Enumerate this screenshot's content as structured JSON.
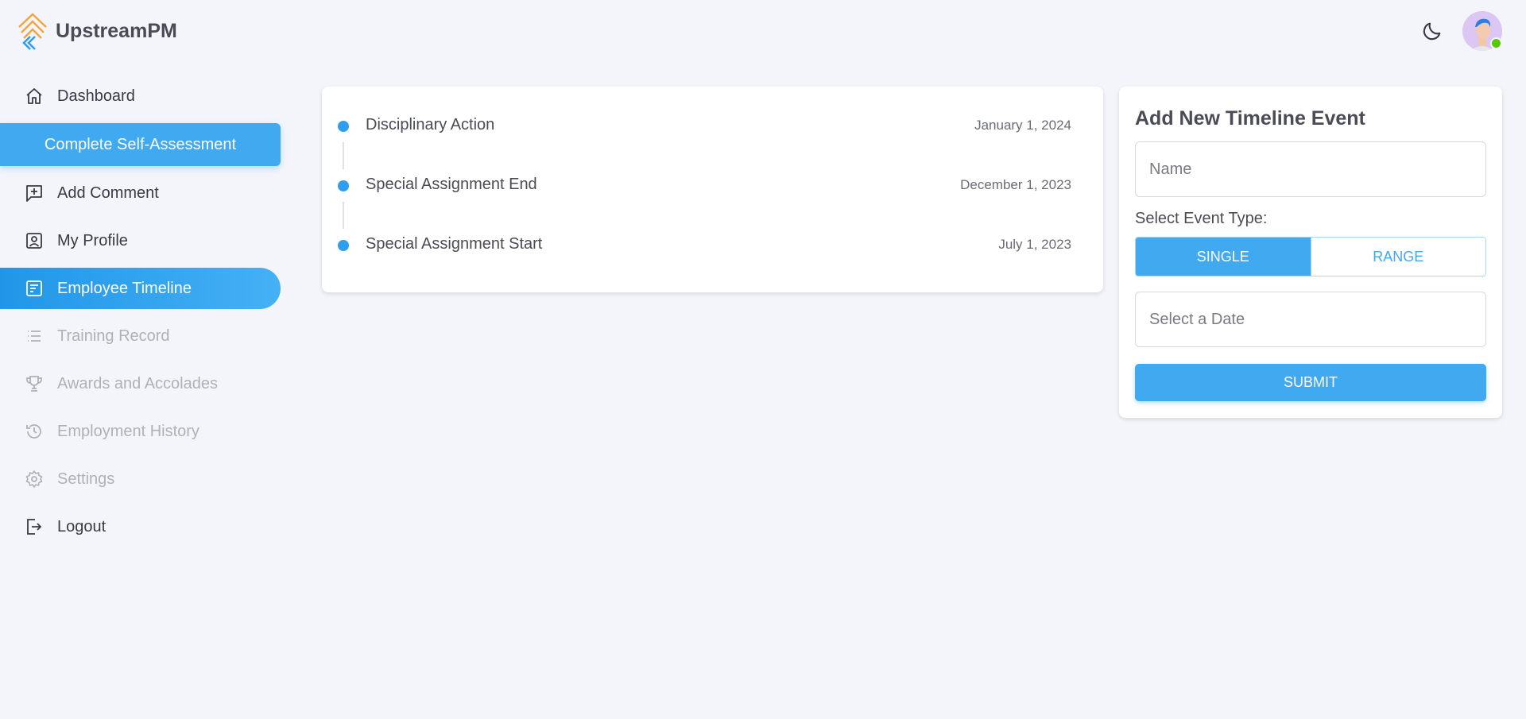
{
  "app": {
    "name": "UpstreamPM"
  },
  "sidebar": {
    "items": [
      {
        "label": "Dashboard",
        "icon": "home-icon",
        "state": "normal"
      },
      {
        "label": "Complete Self-Assessment",
        "state": "cta"
      },
      {
        "label": "Add Comment",
        "icon": "comment-plus-icon",
        "state": "normal"
      },
      {
        "label": "My Profile",
        "icon": "profile-icon",
        "state": "normal"
      },
      {
        "label": "Employee Timeline",
        "icon": "timeline-icon",
        "state": "active"
      },
      {
        "label": "Training Record",
        "icon": "list-icon",
        "state": "disabled"
      },
      {
        "label": "Awards and Accolades",
        "icon": "trophy-icon",
        "state": "disabled"
      },
      {
        "label": "Employment History",
        "icon": "history-icon",
        "state": "disabled"
      },
      {
        "label": "Settings",
        "icon": "gear-icon",
        "state": "disabled"
      },
      {
        "label": "Logout",
        "icon": "logout-icon",
        "state": "normal"
      }
    ]
  },
  "timeline": {
    "events": [
      {
        "title": "Disciplinary Action",
        "date": "January 1, 2024"
      },
      {
        "title": "Special Assignment End",
        "date": "December 1, 2023"
      },
      {
        "title": "Special Assignment Start",
        "date": "July 1, 2023"
      }
    ]
  },
  "form": {
    "title": "Add New Timeline Event",
    "name_placeholder": "Name",
    "event_type_label": "Select Event Type:",
    "single_label": "SINGLE",
    "range_label": "RANGE",
    "date_placeholder": "Select a Date",
    "submit_label": "SUBMIT"
  },
  "colors": {
    "accent": "#40a9ef",
    "online": "#56ca00",
    "background": "#f4f5fa"
  }
}
